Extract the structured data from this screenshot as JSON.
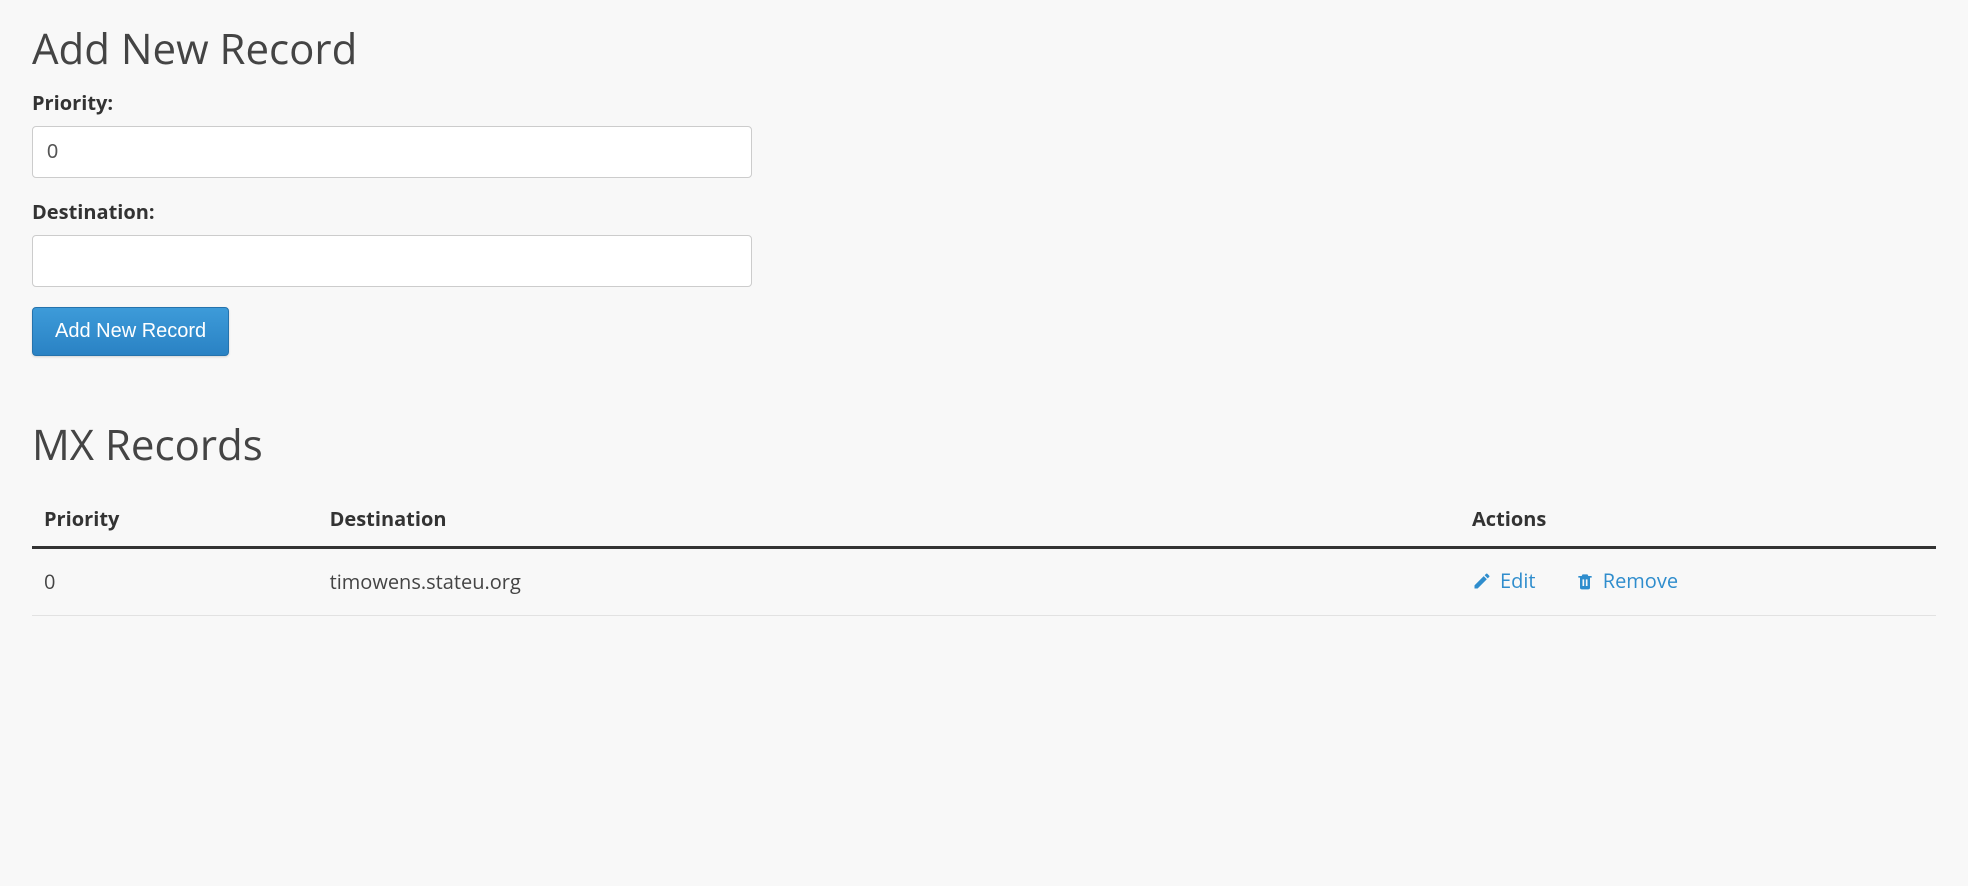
{
  "addRecord": {
    "heading": "Add New Record",
    "priorityLabel": "Priority:",
    "priorityValue": "0",
    "destinationLabel": "Destination:",
    "destinationValue": "",
    "submitLabel": "Add New Record"
  },
  "records": {
    "heading": "MX Records",
    "columns": {
      "priority": "Priority",
      "destination": "Destination",
      "actions": "Actions"
    },
    "rows": [
      {
        "priority": "0",
        "destination": "timowens.stateu.org"
      }
    ],
    "actions": {
      "edit": "Edit",
      "remove": "Remove"
    }
  }
}
